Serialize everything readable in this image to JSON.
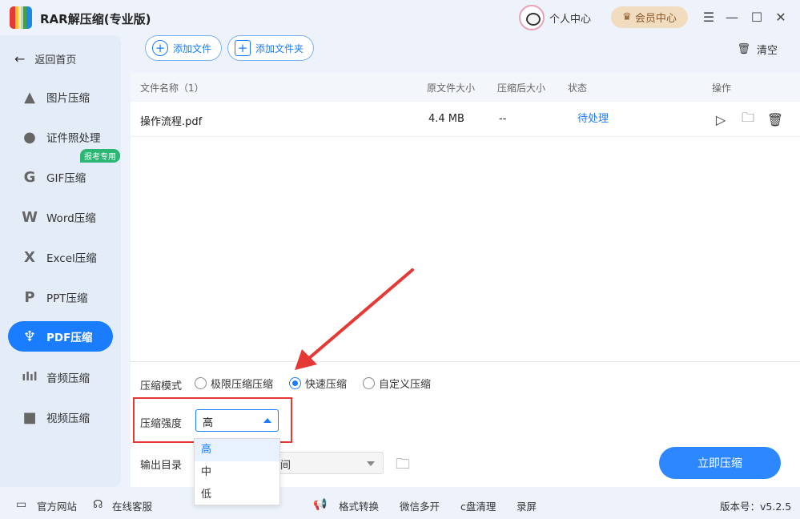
{
  "app": {
    "title": "RAR解压缩(专业版)"
  },
  "header": {
    "personal": "个人中心",
    "vip": "会员中心"
  },
  "sidebar": {
    "back": "返回首页",
    "badge": "报考专用",
    "items": [
      {
        "label": "图片压缩",
        "icon": "image-icon"
      },
      {
        "label": "证件照处理",
        "icon": "id-photo-icon"
      },
      {
        "label": "GIF压缩",
        "icon": "gif-icon"
      },
      {
        "label": "Word压缩",
        "icon": "word-icon"
      },
      {
        "label": "Excel压缩",
        "icon": "excel-icon"
      },
      {
        "label": "PPT压缩",
        "icon": "ppt-icon"
      },
      {
        "label": "PDF压缩",
        "icon": "pdf-icon"
      },
      {
        "label": "音频压缩",
        "icon": "audio-icon"
      },
      {
        "label": "视频压缩",
        "icon": "video-icon"
      }
    ]
  },
  "toolbar": {
    "add_file": "添加文件",
    "add_folder": "添加文件夹",
    "clear": "清空"
  },
  "table": {
    "headers": {
      "name": "文件名称（1）",
      "orig_size": "原文件大小",
      "comp_size": "压缩后大小",
      "status": "状态",
      "ops": "操作"
    },
    "rows": [
      {
        "name": "操作流程.pdf",
        "orig_size": "4.4 MB",
        "comp_size": "--",
        "status": "待处理"
      }
    ]
  },
  "settings": {
    "mode_label": "压缩模式",
    "modes": [
      "极限压缩压缩",
      "快速压缩",
      "自定义压缩"
    ],
    "selected_mode": "快速压缩",
    "strength_label": "压缩强度",
    "strength_value": "高",
    "strength_options": [
      "高",
      "中",
      "低"
    ],
    "output_label": "输出目录",
    "output_value": "间",
    "compress_btn": "立即压缩"
  },
  "footer": {
    "website": "官方网站",
    "service": "在线客服",
    "links": [
      "格式转换",
      "微信多开",
      "c盘清理",
      "录屏"
    ],
    "version": "版本号：v5.2.5"
  },
  "colors": {
    "accent": "#1a7cff",
    "highlight": "#e53935",
    "status": "#1a7cff"
  }
}
